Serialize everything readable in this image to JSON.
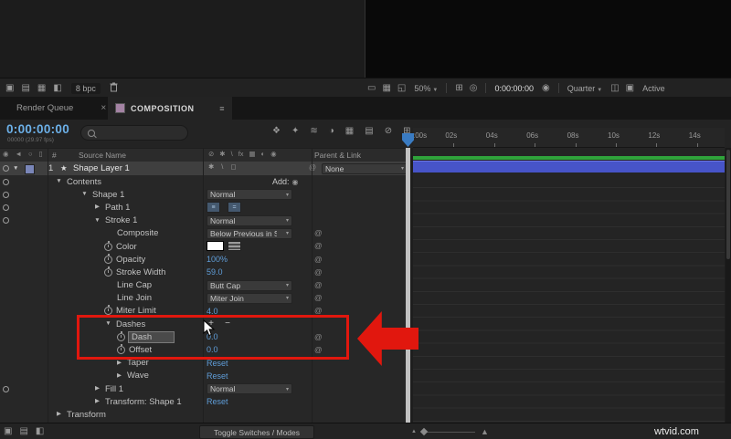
{
  "top_toolbar": {
    "bpc": "8 bpc",
    "zoom": "50%",
    "timecode": "0:00:00:00",
    "resolution": "Quarter",
    "view": "Active"
  },
  "tabs": {
    "render_queue": "Render Queue",
    "close": "×",
    "composition": "COMPOSITION",
    "menu": "≡"
  },
  "timeline_header": {
    "timecode": "0:00:00:00",
    "frames": "00000 (29.97 fps)",
    "ruler": [
      ":00s",
      "02s",
      "04s",
      "06s",
      "08s",
      "10s",
      "12s",
      "14s"
    ]
  },
  "columns": {
    "hash": "#",
    "source_name": "Source Name",
    "parent_link": "Parent & Link"
  },
  "layer": {
    "index": "1",
    "name": "Shape Layer 1",
    "parent": "None"
  },
  "glyphs": {
    "caret-down": "▼",
    "caret-right": "▶",
    "dropdown-caret": "▾",
    "plus": "+",
    "minus": "−",
    "pickwhip": "@",
    "add-button": "◉",
    "star": "★",
    "path-lines": "≡",
    "path-eq": "="
  },
  "toolbar_left_icons": [
    {
      "name": "workspace",
      "glyph": "▣"
    },
    {
      "name": "panels",
      "glyph": "▤"
    },
    {
      "name": "grid",
      "glyph": "▦"
    },
    {
      "name": "guides",
      "glyph": "◧"
    }
  ],
  "toolbar_right_icons_a": [
    {
      "name": "monitor",
      "glyph": "▭"
    },
    {
      "name": "channels",
      "glyph": "▦"
    },
    {
      "name": "region-of-interest",
      "glyph": "◱"
    }
  ],
  "toolbar_right_icons_b": [
    {
      "name": "grid-overlay",
      "glyph": "⊞"
    },
    {
      "name": "mask-visibility",
      "glyph": "◎"
    }
  ],
  "toolbar_right_icons_c": [
    {
      "name": "snapshot-camera",
      "glyph": "◉"
    }
  ],
  "toolbar_right_icons_d": [
    {
      "name": "fast-preview",
      "glyph": "◫"
    },
    {
      "name": "panel-options",
      "glyph": "▣"
    }
  ],
  "tl_header_icons": [
    {
      "name": "composition-mini-flowchart",
      "glyph": "❖"
    },
    {
      "name": "draft-3d",
      "glyph": "✦"
    },
    {
      "name": "frame-blending",
      "glyph": "≋"
    },
    {
      "name": "motion-blur",
      "glyph": "◑"
    },
    {
      "name": "graph-editor",
      "glyph": "▦"
    },
    {
      "name": "transparency-grid",
      "glyph": "▤"
    },
    {
      "name": "shy-layers",
      "glyph": "⊘"
    },
    {
      "name": "live-update",
      "glyph": "⊞"
    }
  ],
  "av_header_icons": [
    {
      "name": "video-eye",
      "glyph": "◉"
    },
    {
      "name": "audio-speaker",
      "glyph": "◄"
    },
    {
      "name": "solo",
      "glyph": "○"
    },
    {
      "name": "lock",
      "glyph": "▯"
    }
  ],
  "switch_header_icons": [
    {
      "name": "shy-switch",
      "glyph": "⊘"
    },
    {
      "name": "collapse-transformations",
      "glyph": "✱"
    },
    {
      "name": "quality",
      "glyph": "\\"
    },
    {
      "name": "effects",
      "glyph": "fx"
    },
    {
      "name": "frame-blend",
      "glyph": "▦"
    },
    {
      "name": "motion-blur-switch",
      "glyph": "◐"
    },
    {
      "name": "3d-layer",
      "glyph": "◉"
    }
  ],
  "layer_switch_icons": [
    {
      "name": "quality",
      "glyph": "✱"
    },
    {
      "name": "effects",
      "glyph": "\\"
    },
    {
      "name": "3d-layer",
      "glyph": "◻"
    }
  ],
  "bottom_left_icons": [
    {
      "name": "composition-network",
      "glyph": "▣"
    },
    {
      "name": "flowchart",
      "glyph": "▤"
    },
    {
      "name": "panel",
      "glyph": "◧"
    }
  ],
  "properties": [
    {
      "id": "contents",
      "label": "Contents",
      "pad": 60,
      "caret": "down",
      "eye": true,
      "value": {
        "type": "add",
        "text": "Add:"
      },
      "pickwhip": false
    },
    {
      "id": "shape-1",
      "label": "Shape 1",
      "pad": 88,
      "caret": "down",
      "eye": true,
      "value": {
        "type": "mode",
        "text": "Normal"
      },
      "pickwhip": false
    },
    {
      "id": "path-1",
      "label": "Path 1",
      "pad": 102,
      "caret": "right",
      "eye": true,
      "value": {
        "type": "path"
      },
      "pickwhip": false
    },
    {
      "id": "stroke-1",
      "label": "Stroke 1",
      "pad": 102,
      "caret": "down",
      "eye": true,
      "value": {
        "type": "mode",
        "text": "Normal"
      },
      "pickwhip": false
    },
    {
      "id": "composite",
      "label": "Composite",
      "pad": 128,
      "value": {
        "type": "mode",
        "text": "Below Previous in Sa"
      },
      "pickwhip": true
    },
    {
      "id": "color",
      "label": "Color",
      "pad": 114,
      "stopwatch": true,
      "value": {
        "type": "swatch"
      },
      "pickwhip": true
    },
    {
      "id": "opacity",
      "label": "Opacity",
      "pad": 114,
      "stopwatch": true,
      "value": {
        "type": "scrub",
        "text": "100%"
      },
      "pickwhip": true
    },
    {
      "id": "stroke-width",
      "label": "Stroke Width",
      "pad": 114,
      "stopwatch": true,
      "value": {
        "type": "scrub",
        "text": "59.0"
      },
      "pickwhip": true
    },
    {
      "id": "line-cap",
      "label": "Line Cap",
      "pad": 128,
      "value": {
        "type": "mode",
        "text": "Butt Cap"
      },
      "pickwhip": true
    },
    {
      "id": "line-join",
      "label": "Line Join",
      "pad": 128,
      "value": {
        "type": "mode",
        "text": "Miter Join"
      },
      "pickwhip": true
    },
    {
      "id": "miter-limit",
      "label": "Miter Limit",
      "pad": 114,
      "stopwatch": true,
      "value": {
        "type": "scrub",
        "text": "4.0"
      },
      "pickwhip": true
    },
    {
      "id": "dashes",
      "label": "Dashes",
      "pad": 114,
      "caret": "down",
      "value": {
        "type": "plusminus"
      },
      "pickwhip": false
    },
    {
      "id": "dash",
      "label": "Dash",
      "pad": 128,
      "stopwatch": true,
      "selected": true,
      "value": {
        "type": "scrub",
        "text": "0.0"
      },
      "pickwhip": true
    },
    {
      "id": "offset",
      "label": "Offset",
      "pad": 128,
      "stopwatch": true,
      "value": {
        "type": "scrub",
        "text": "0.0"
      },
      "pickwhip": true
    },
    {
      "id": "taper",
      "label": "Taper",
      "pad": 126,
      "caret": "right",
      "value": {
        "type": "reset",
        "text": "Reset"
      },
      "pickwhip": false
    },
    {
      "id": "wave",
      "label": "Wave",
      "pad": 126,
      "caret": "right",
      "value": {
        "type": "reset",
        "text": "Reset"
      },
      "pickwhip": false
    },
    {
      "id": "fill-1",
      "label": "Fill 1",
      "pad": 102,
      "caret": "right",
      "eye": true,
      "value": {
        "type": "mode",
        "text": "Normal"
      },
      "pickwhip": false
    },
    {
      "id": "transform-shape-1",
      "label": "Transform: Shape 1",
      "pad": 102,
      "caret": "right",
      "value": {
        "type": "reset",
        "text": "Reset"
      },
      "pickwhip": false
    },
    {
      "id": "transform",
      "label": "Transform",
      "pad": 60,
      "caret": "right",
      "value": null,
      "pickwhip": false
    }
  ],
  "bottom_bar": {
    "toggle": "Toggle Switches / Modes",
    "watermark": "wtvid.com"
  },
  "colors": {
    "highlight_red": "#e1170e",
    "value_blue": "#5f9dd8",
    "timecode_blue": "#6cb0e8",
    "layer_bar_blue": "#4754c8",
    "render_bar_green": "#2fa33b"
  }
}
